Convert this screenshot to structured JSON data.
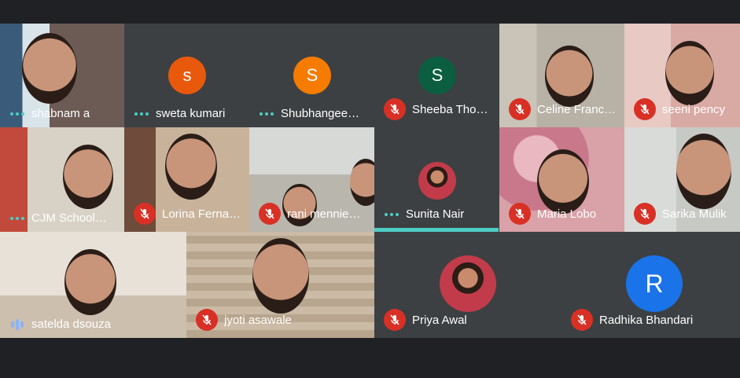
{
  "participants": [
    {
      "name": "shabnam a",
      "status": "speaking-dots"
    },
    {
      "name": "sweta kumari",
      "status": "speaking-dots",
      "initial": "s",
      "color": "#e8590c"
    },
    {
      "name": "Shubhangee…",
      "status": "speaking-dots",
      "initial": "S",
      "color": "#f57c00"
    },
    {
      "name": "Sheeba Tho…",
      "status": "muted",
      "initial": "S",
      "color": "#0b5e40"
    },
    {
      "name": "Celine Franc…",
      "status": "muted"
    },
    {
      "name": "seeni pency",
      "status": "muted"
    },
    {
      "name": "CJM School…",
      "status": "speaking-dots"
    },
    {
      "name": "Lorina Ferna…",
      "status": "muted"
    },
    {
      "name": "rani mennie…",
      "status": "muted"
    },
    {
      "name": "Sunita Nair",
      "status": "speaking-dots"
    },
    {
      "name": "Maria Lobo",
      "status": "muted"
    },
    {
      "name": "Sarika Mulik",
      "status": "muted"
    },
    {
      "name": "satelda dsouza",
      "status": "audio-bars"
    },
    {
      "name": "jyoti asawale",
      "status": "muted"
    },
    {
      "name": "Priya Awal",
      "status": "muted"
    },
    {
      "name": "Radhika Bhandari",
      "status": "muted",
      "initial": "R",
      "color": "#1a73e8"
    }
  ],
  "icons": {
    "muted": "mic-off-icon",
    "speaking": "speaking-dots-icon",
    "audio": "audio-bars-icon"
  },
  "colors": {
    "background": "#202124",
    "tile": "#3c4043",
    "mute": "#d93025",
    "speaking": "#4ecdc4"
  }
}
